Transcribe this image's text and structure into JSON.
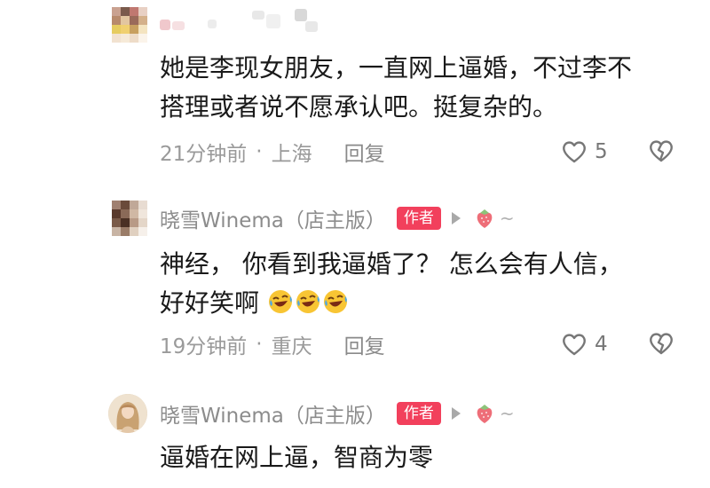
{
  "comments": [
    {
      "username": "",
      "content_lines": [
        "她是李现女朋友，一直网上逼婚，不过李不",
        "搭理或者说不愿承认吧。挺复杂的。"
      ],
      "time": "21分钟前",
      "location": "上海",
      "reply_label": "回复",
      "likes": "5"
    },
    {
      "username": "晓雪Winema（店主版）",
      "badge": "作者",
      "content_lines": [
        "神经， 你看到我逼婚了？ 怎么会有人信，",
        "好好笑啊"
      ],
      "emoji_names": [
        "rolling-laughing-emoji",
        "rolling-laughing-emoji",
        "rolling-laughing-emoji"
      ],
      "time": "19分钟前",
      "location": "重庆",
      "reply_label": "回复",
      "likes": "4"
    },
    {
      "username": "晓雪Winema（店主版）",
      "badge": "作者",
      "content_lines": [
        "逼婚在网上逼，智商为零"
      ]
    }
  ],
  "meta_separator": "·",
  "icons": {
    "like": "heart-outline-icon",
    "dislike": "broken-heart-icon",
    "play": "play-triangle-icon",
    "fan_badge": "strawberry-icon"
  },
  "colors": {
    "badge_bg": "#f2405c",
    "meta_text": "#9a9a9a",
    "username_text": "#8c8c8c"
  }
}
